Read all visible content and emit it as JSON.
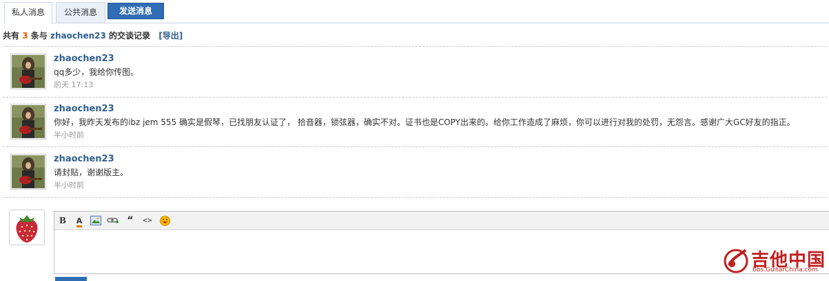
{
  "tabs": {
    "private": "私人消息",
    "public": "公共消息",
    "send": "发送消息"
  },
  "summary": {
    "prefix": "共有",
    "count": "3",
    "mid": "条与",
    "user": "zhaochen23",
    "suffix": "的交谈记录",
    "export": "[导出]"
  },
  "messages": [
    {
      "name": "zhaochen23",
      "text": "qq多少，我给你传图。",
      "time": "前天 17:13"
    },
    {
      "name": "zhaochen23",
      "text": "你好，我昨天发布的ibz jem 555 确实是假琴，已找朋友认证了，  拾音器，锁弦器，确实不对。证书也是COPY出来的。给你工作造成了麻烦，你可以进行对我的处罚，无怨言。感谢广大GC好友的指正。",
      "time": "半小时前"
    },
    {
      "name": "zhaochen23",
      "text": "请封贴，谢谢版主。",
      "time": "半小时前"
    }
  ],
  "toolbar": {
    "bold": "B",
    "color": "A",
    "quote": "“",
    "code": "<>"
  },
  "watermark": {
    "title": "吉他中国",
    "url": "bbs.GuitarChina.com"
  },
  "colors": {
    "accent": "#2f6db5",
    "link": "#2f5f8f",
    "count": "#e05a00",
    "watermark": "#c02020"
  }
}
